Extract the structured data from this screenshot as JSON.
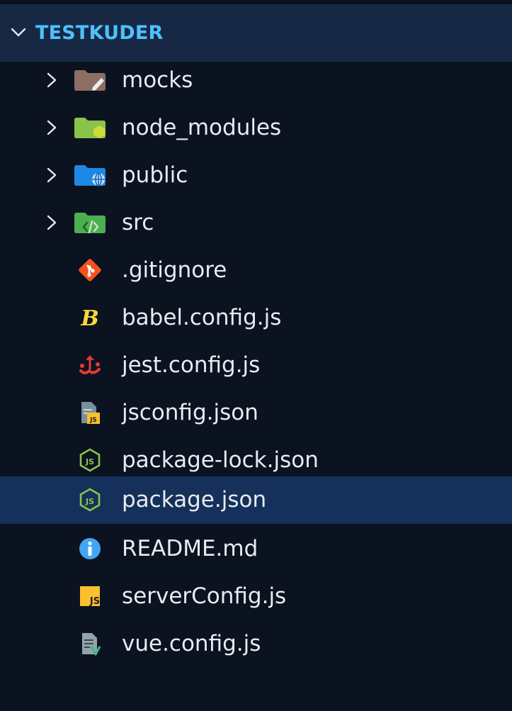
{
  "explorer": {
    "root_title": "TESTKUDER",
    "items": [
      {
        "label": "mocks",
        "kind": "folder",
        "icon": "folder-mocks-icon"
      },
      {
        "label": "node_modules",
        "kind": "folder",
        "icon": "folder-node-icon"
      },
      {
        "label": "public",
        "kind": "folder",
        "icon": "folder-public-icon"
      },
      {
        "label": "src",
        "kind": "folder",
        "icon": "folder-src-icon"
      },
      {
        "label": ".gitignore",
        "kind": "file",
        "icon": "git-icon"
      },
      {
        "label": "babel.config.js",
        "kind": "file",
        "icon": "babel-icon"
      },
      {
        "label": "jest.config.js",
        "kind": "file",
        "icon": "jest-icon"
      },
      {
        "label": "jsconfig.json",
        "kind": "file",
        "icon": "jsconfig-icon"
      },
      {
        "label": "package-lock.json",
        "kind": "file",
        "icon": "nodejs-icon"
      },
      {
        "label": "package.json",
        "kind": "file",
        "icon": "nodejs-icon",
        "selected": true
      },
      {
        "label": "README.md",
        "kind": "file",
        "icon": "info-icon"
      },
      {
        "label": "serverConfig.js",
        "kind": "file",
        "icon": "javascript-icon"
      },
      {
        "label": "vue.config.js",
        "kind": "file",
        "icon": "config-file-icon"
      }
    ]
  },
  "colors": {
    "background": "#0b1220",
    "header_background": "#162844",
    "header_text": "#4cc2ff",
    "selection": "#15305a",
    "text": "#e8ebf0"
  }
}
